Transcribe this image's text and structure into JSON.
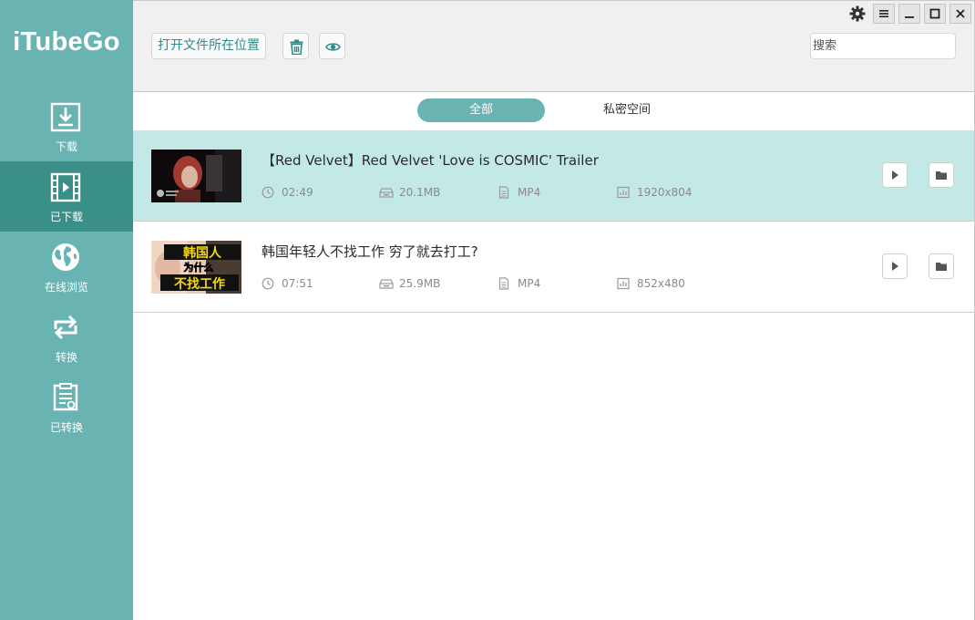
{
  "app": {
    "logo": "iTubeGo"
  },
  "sidebar": {
    "items": [
      {
        "label": "下载",
        "icon": "download-icon"
      },
      {
        "label": "已下载",
        "icon": "film-icon",
        "active": true
      },
      {
        "label": "在线浏览",
        "icon": "globe-icon"
      },
      {
        "label": "转换",
        "icon": "convert-icon"
      },
      {
        "label": "已转换",
        "icon": "converted-list-icon"
      }
    ]
  },
  "toolbar": {
    "open_folder_label": "打开文件所在位置",
    "delete_icon": "trash-icon",
    "preview_icon": "eye-icon",
    "search_placeholder": "搜索",
    "settings_icon": "gear-icon",
    "window_controls": [
      "menu-icon",
      "minimize-icon",
      "maximize-icon",
      "close-icon"
    ]
  },
  "tabs": [
    {
      "label": "全部",
      "active": true
    },
    {
      "label": "私密空间",
      "active": false
    }
  ],
  "videos": [
    {
      "title": "【Red Velvet】Red Velvet 'Love is COSMIC' Trailer",
      "duration": "02:49",
      "size": "20.1MB",
      "format": "MP4",
      "resolution": "1920x804",
      "selected": true
    },
    {
      "title": "韩国年轻人不找工作 穷了就去打工?",
      "duration": "07:51",
      "size": "25.9MB",
      "format": "MP4",
      "resolution": "852x480",
      "selected": false,
      "thumb_text": [
        "韩国人",
        "为什么",
        "不找工作"
      ]
    }
  ],
  "colors": {
    "sidebar": "#6ab3b3",
    "sidebar_active": "#3a9088",
    "selected_row": "#c3e9e7",
    "accent_text": "#2f8b8b"
  }
}
